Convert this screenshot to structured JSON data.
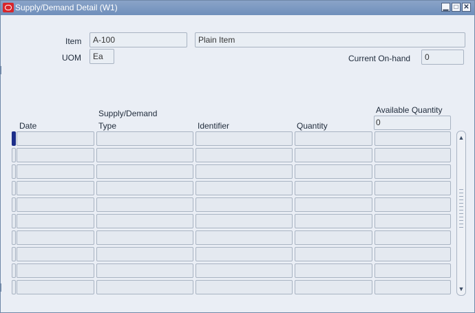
{
  "window": {
    "title": "Supply/Demand Detail (W1)",
    "controls": {
      "minimize": "▁",
      "maximize": "□",
      "close": "✕"
    }
  },
  "header": {
    "item_label": "Item",
    "item_value": "A-100",
    "item_description": "Plain Item",
    "uom_label": "UOM",
    "uom_value": "Ea",
    "onhand_label": "Current On-hand",
    "onhand_value": "0"
  },
  "table": {
    "columns": {
      "date": "Date",
      "type_line1": "Supply/Demand",
      "type_line2": "Type",
      "identifier": "Identifier",
      "quantity": "Quantity",
      "available": "Available Quantity"
    },
    "available_initial": "0",
    "row_count": 10
  },
  "icons": {
    "app_logo": "oracle-logo-icon",
    "scroll_up": "arrow-up-icon",
    "scroll_down": "arrow-down-icon"
  },
  "colors": {
    "titlebar": "#7a97c0",
    "background": "#eaeef5",
    "current_row": "#1d2f8a"
  }
}
